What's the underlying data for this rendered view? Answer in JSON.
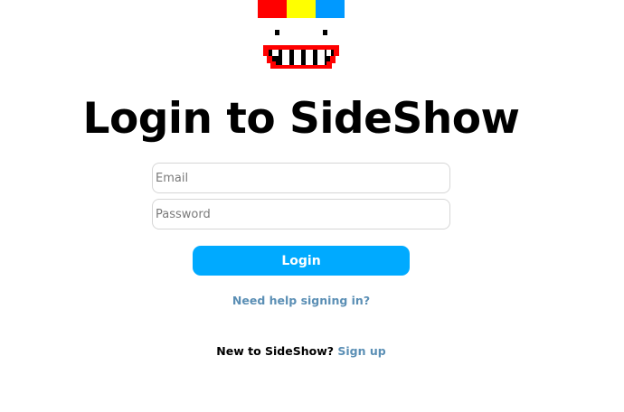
{
  "logo": {
    "name": "sideshow-logo",
    "hat_colors": [
      "#ff0000",
      "#ffff00",
      "#0099ff"
    ],
    "mouth_color": "#ff0000"
  },
  "title": "Login to SideShow",
  "form": {
    "email_placeholder": "Email",
    "email_value": "",
    "password_placeholder": "Password",
    "password_value": "",
    "login_label": "Login"
  },
  "links": {
    "help": "Need help signing in?",
    "signup_prompt": "New to SideShow?",
    "signup": "Sign up"
  },
  "colors": {
    "accent": "#00aaff",
    "link": "#5b8fb5"
  }
}
